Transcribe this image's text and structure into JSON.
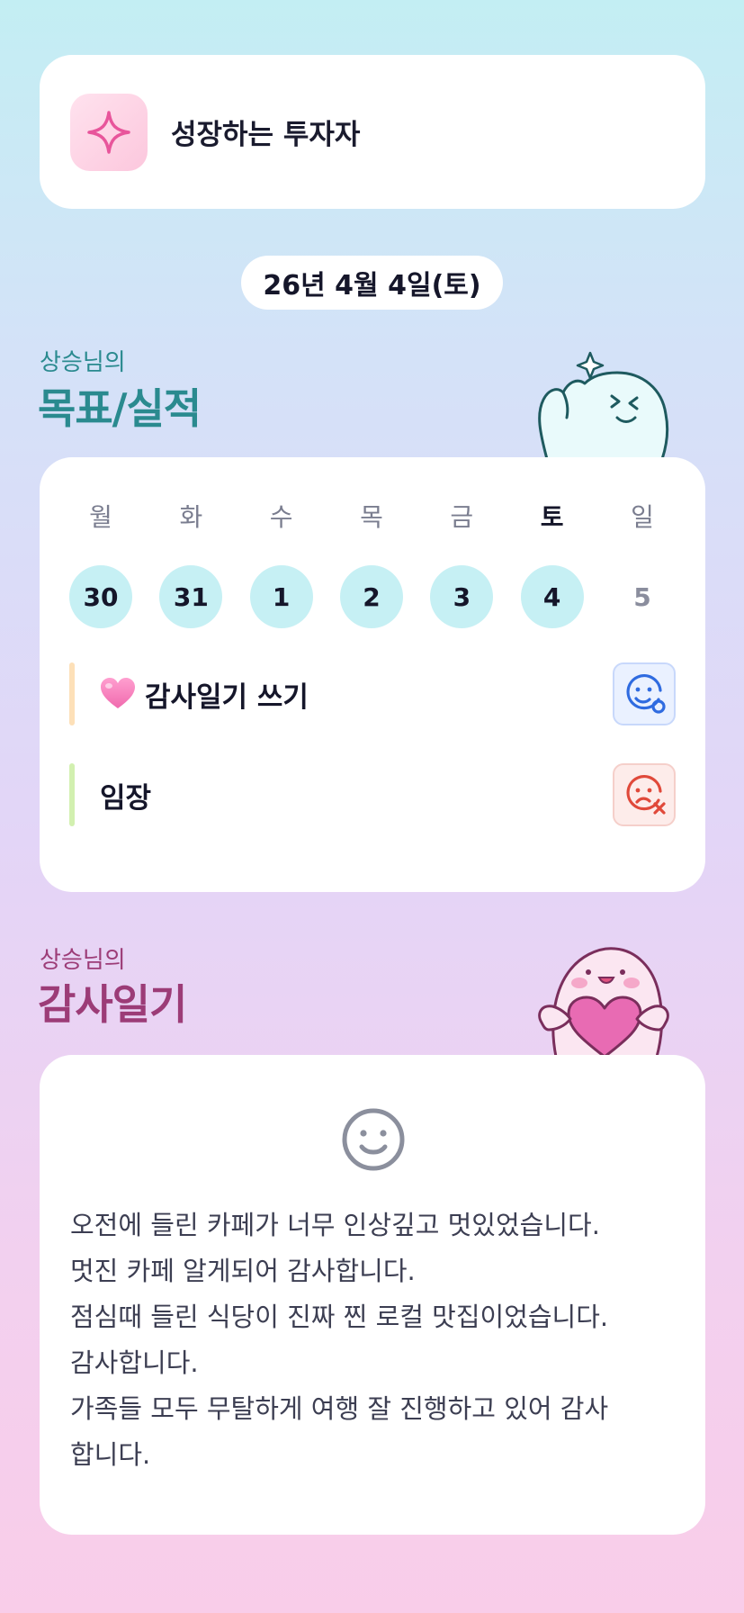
{
  "profile": {
    "icon": "sparkle-icon",
    "title": "성장하는 투자자"
  },
  "date_pill": "26년 4월 4일(토)",
  "goals_section": {
    "subtitle": "상승님의",
    "title": "목표/실적",
    "mascot": "ghost-mascot-thumbs-up"
  },
  "week": {
    "days": [
      {
        "label": "월",
        "num": "30",
        "state": "filled"
      },
      {
        "label": "화",
        "num": "31",
        "state": "filled"
      },
      {
        "label": "수",
        "num": "1",
        "state": "filled"
      },
      {
        "label": "목",
        "num": "2",
        "state": "filled"
      },
      {
        "label": "금",
        "num": "3",
        "state": "filled"
      },
      {
        "label": "토",
        "num": "4",
        "state": "filled",
        "active": true
      },
      {
        "label": "일",
        "num": "5",
        "state": "future"
      }
    ]
  },
  "goals": [
    {
      "name": "감사일기 쓰기",
      "icon": "heart-icon",
      "bar_color": "#fde0b8",
      "status": "achieved",
      "status_icon": "smile-check-icon"
    },
    {
      "name": "임장",
      "icon": "",
      "bar_color": "#d2f0b0",
      "status": "missed",
      "status_icon": "sad-x-icon"
    }
  ],
  "diary_section": {
    "subtitle": "상승님의",
    "title": "감사일기",
    "mascot": "pink-mascot-heart"
  },
  "diary": {
    "mood_icon": "smile-face-icon",
    "lines": [
      "오전에 들린 카페가 너무 인상깊고 멋있었습니다.",
      "멋진 카페 알게되어 감사합니다.",
      "점심때 들린 식당이 진짜 찐 로컬 맛집이었습니다.",
      "감사합니다.",
      "가족들 모두 무탈하게 여행 잘 진행하고 있어 감사",
      "합니다."
    ]
  },
  "colors": {
    "goal_accent": "#2a8a8f",
    "diary_accent": "#9c3c77",
    "day_fill": "#c6f0f4",
    "status_good": "#2f6be0",
    "status_bad": "#e0493a"
  }
}
